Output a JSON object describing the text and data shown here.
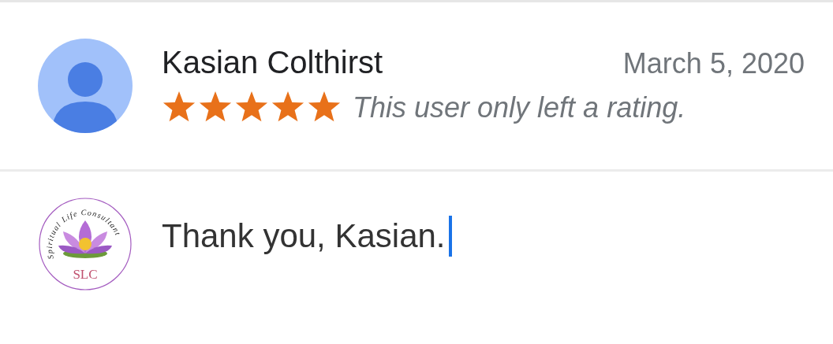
{
  "review": {
    "author": "Kasian Colthirst",
    "date": "March 5, 2020",
    "stars": 5,
    "note": "This user only left a rating."
  },
  "reply": {
    "logo": {
      "ring_text": "Spiritual  Life  Consultant",
      "initials": "SLC"
    },
    "value": "Thank you, Kasian."
  }
}
